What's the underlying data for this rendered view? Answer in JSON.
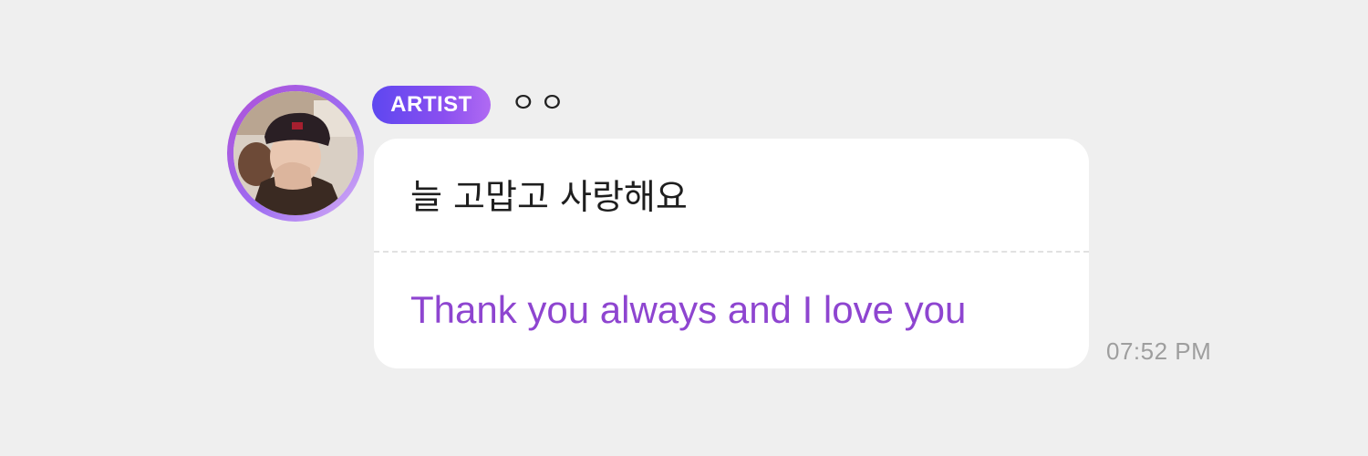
{
  "message": {
    "badge_label": "ARTIST",
    "sender_name": "ㅇㅇ",
    "original_text": "늘 고맙고 사랑해요",
    "translated_text": "Thank you always and I love you",
    "timestamp": "07:52 PM",
    "avatar_icon": "artist-avatar-photo"
  },
  "colors": {
    "background": "#efefef",
    "bubble": "#ffffff",
    "badge_gradient_start": "#5e47f0",
    "badge_gradient_end": "#b06af2",
    "translation_text": "#8e45d0",
    "timestamp_text": "#9e9e9e"
  }
}
